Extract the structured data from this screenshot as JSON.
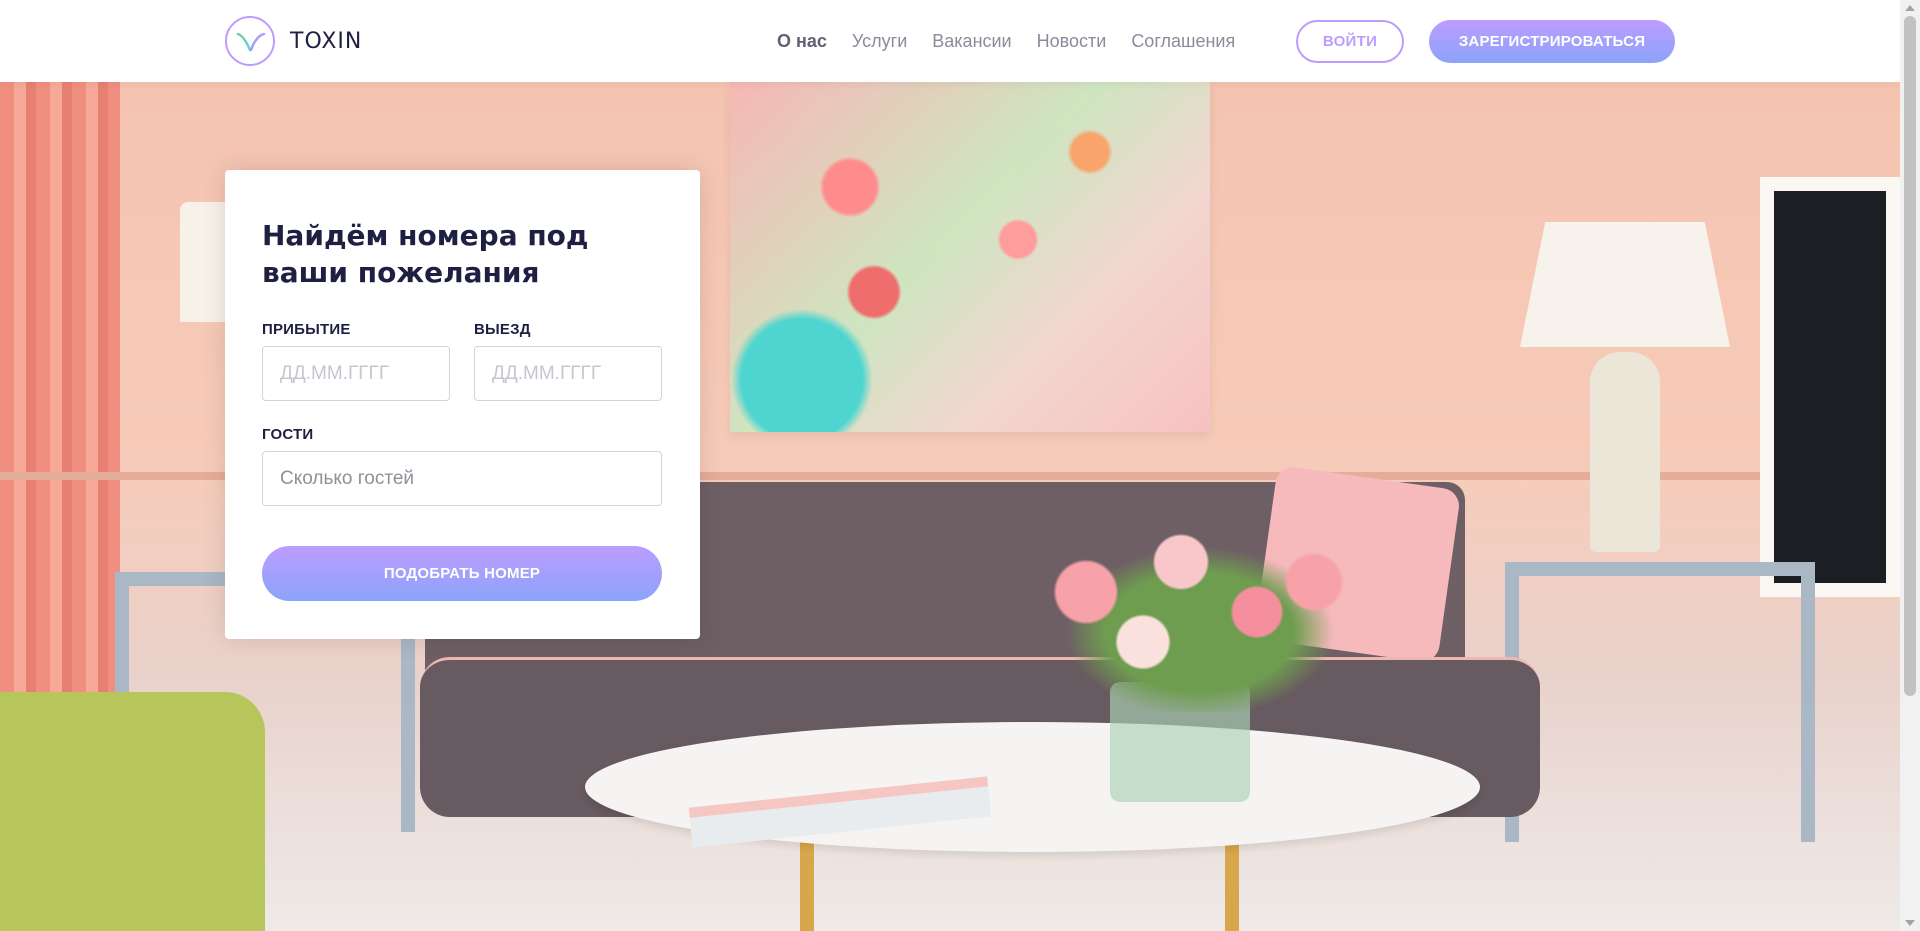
{
  "header": {
    "logo_text": "TOXIN",
    "nav": [
      {
        "label": "О нас",
        "active": true
      },
      {
        "label": "Услуги",
        "active": false
      },
      {
        "label": "Вакансии",
        "active": false
      },
      {
        "label": "Новости",
        "active": false
      },
      {
        "label": "Соглашения",
        "active": false
      }
    ],
    "login_label": "ВОЙТИ",
    "register_label": "ЗАРЕГИСТРИРОВАТЬСЯ"
  },
  "search_card": {
    "title": "Найдём номера под ваши пожелания",
    "arrival": {
      "label": "ПРИБЫТИЕ",
      "placeholder": "ДД.ММ.ГГГГ",
      "value": ""
    },
    "departure": {
      "label": "ВЫЕЗД",
      "placeholder": "ДД.ММ.ГГГГ",
      "value": ""
    },
    "guests": {
      "label": "ГОСТИ",
      "placeholder": "Сколько гостей",
      "value": ""
    },
    "submit_label": "ПОДОБРАТЬ НОМЕР"
  },
  "icons": {
    "logo": "logo-icon",
    "scroll_up": "scroll-up-arrow-icon",
    "scroll_down": "scroll-down-arrow-icon"
  },
  "colors": {
    "accent": "#bc9cff",
    "accent_gradient_end": "#8ba4f9",
    "text_dark": "#1f2041",
    "text_muted": "#8a8b9c"
  }
}
